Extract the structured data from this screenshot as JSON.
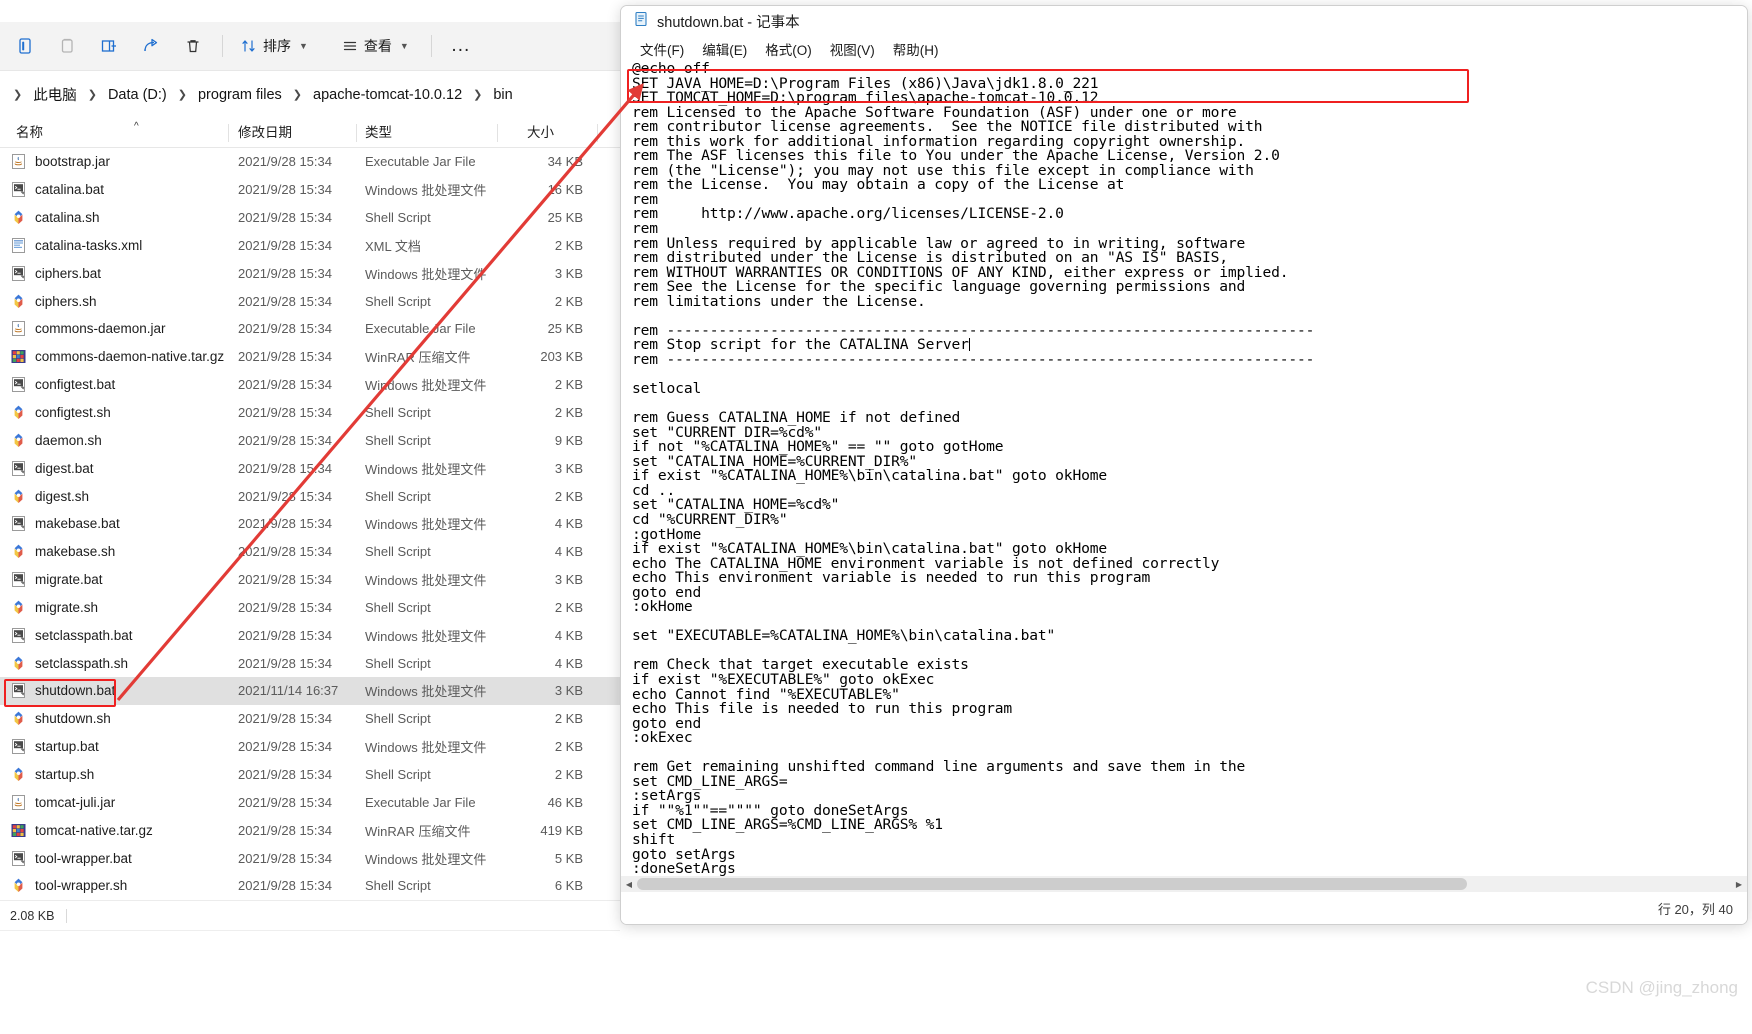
{
  "explorer": {
    "toolbar": {
      "buttons": [
        {
          "name": "new-item-icon",
          "label": ""
        },
        {
          "name": "cut-icon",
          "label": ""
        },
        {
          "name": "copy-icon",
          "label": ""
        },
        {
          "name": "paste-icon",
          "label": ""
        },
        {
          "name": "rename-icon",
          "label": ""
        },
        {
          "name": "share-icon",
          "label": ""
        },
        {
          "name": "delete-icon",
          "label": ""
        }
      ],
      "sort_label": "排序",
      "view_label": "查看",
      "more_label": "..."
    },
    "breadcrumb": [
      "此电脑",
      "Data (D:)",
      "program files",
      "apache-tomcat-10.0.12",
      "bin"
    ],
    "columns": [
      "名称",
      "修改日期",
      "类型",
      "大小"
    ],
    "files": [
      {
        "name": "bootstrap.jar",
        "date": "2021/9/28 15:34",
        "type": "Executable Jar File",
        "size": "34 KB",
        "icon": "jar-icon",
        "selected": false
      },
      {
        "name": "catalina.bat",
        "date": "2021/9/28 15:34",
        "type": "Windows 批处理文件",
        "size": "16 KB",
        "icon": "bat-icon",
        "selected": false
      },
      {
        "name": "catalina.sh",
        "date": "2021/9/28 15:34",
        "type": "Shell Script",
        "size": "25 KB",
        "icon": "sh-icon",
        "selected": false
      },
      {
        "name": "catalina-tasks.xml",
        "date": "2021/9/28 15:34",
        "type": "XML 文档",
        "size": "2 KB",
        "icon": "xml-icon",
        "selected": false
      },
      {
        "name": "ciphers.bat",
        "date": "2021/9/28 15:34",
        "type": "Windows 批处理文件",
        "size": "3 KB",
        "icon": "bat-icon",
        "selected": false
      },
      {
        "name": "ciphers.sh",
        "date": "2021/9/28 15:34",
        "type": "Shell Script",
        "size": "2 KB",
        "icon": "sh-icon",
        "selected": false
      },
      {
        "name": "commons-daemon.jar",
        "date": "2021/9/28 15:34",
        "type": "Executable Jar File",
        "size": "25 KB",
        "icon": "jar-icon",
        "selected": false
      },
      {
        "name": "commons-daemon-native.tar.gz",
        "date": "2021/9/28 15:34",
        "type": "WinRAR 压缩文件",
        "size": "203 KB",
        "icon": "rar-icon",
        "selected": false
      },
      {
        "name": "configtest.bat",
        "date": "2021/9/28 15:34",
        "type": "Windows 批处理文件",
        "size": "2 KB",
        "icon": "bat-icon",
        "selected": false
      },
      {
        "name": "configtest.sh",
        "date": "2021/9/28 15:34",
        "type": "Shell Script",
        "size": "2 KB",
        "icon": "sh-icon",
        "selected": false
      },
      {
        "name": "daemon.sh",
        "date": "2021/9/28 15:34",
        "type": "Shell Script",
        "size": "9 KB",
        "icon": "sh-icon",
        "selected": false
      },
      {
        "name": "digest.bat",
        "date": "2021/9/28 15:34",
        "type": "Windows 批处理文件",
        "size": "3 KB",
        "icon": "bat-icon",
        "selected": false
      },
      {
        "name": "digest.sh",
        "date": "2021/9/28 15:34",
        "type": "Shell Script",
        "size": "2 KB",
        "icon": "sh-icon",
        "selected": false
      },
      {
        "name": "makebase.bat",
        "date": "2021/9/28 15:34",
        "type": "Windows 批处理文件",
        "size": "4 KB",
        "icon": "bat-icon",
        "selected": false
      },
      {
        "name": "makebase.sh",
        "date": "2021/9/28 15:34",
        "type": "Shell Script",
        "size": "4 KB",
        "icon": "sh-icon",
        "selected": false
      },
      {
        "name": "migrate.bat",
        "date": "2021/9/28 15:34",
        "type": "Windows 批处理文件",
        "size": "3 KB",
        "icon": "bat-icon",
        "selected": false
      },
      {
        "name": "migrate.sh",
        "date": "2021/9/28 15:34",
        "type": "Shell Script",
        "size": "2 KB",
        "icon": "sh-icon",
        "selected": false
      },
      {
        "name": "setclasspath.bat",
        "date": "2021/9/28 15:34",
        "type": "Windows 批处理文件",
        "size": "4 KB",
        "icon": "bat-icon",
        "selected": false
      },
      {
        "name": "setclasspath.sh",
        "date": "2021/9/28 15:34",
        "type": "Shell Script",
        "size": "4 KB",
        "icon": "sh-icon",
        "selected": false
      },
      {
        "name": "shutdown.bat",
        "date": "2021/11/14 16:37",
        "type": "Windows 批处理文件",
        "size": "3 KB",
        "icon": "bat-icon",
        "selected": true
      },
      {
        "name": "shutdown.sh",
        "date": "2021/9/28 15:34",
        "type": "Shell Script",
        "size": "2 KB",
        "icon": "sh-icon",
        "selected": false
      },
      {
        "name": "startup.bat",
        "date": "2021/9/28 15:34",
        "type": "Windows 批处理文件",
        "size": "2 KB",
        "icon": "bat-icon",
        "selected": false
      },
      {
        "name": "startup.sh",
        "date": "2021/9/28 15:34",
        "type": "Shell Script",
        "size": "2 KB",
        "icon": "sh-icon",
        "selected": false
      },
      {
        "name": "tomcat-juli.jar",
        "date": "2021/9/28 15:34",
        "type": "Executable Jar File",
        "size": "46 KB",
        "icon": "jar-icon",
        "selected": false
      },
      {
        "name": "tomcat-native.tar.gz",
        "date": "2021/9/28 15:34",
        "type": "WinRAR 压缩文件",
        "size": "419 KB",
        "icon": "rar-icon",
        "selected": false
      },
      {
        "name": "tool-wrapper.bat",
        "date": "2021/9/28 15:34",
        "type": "Windows 批处理文件",
        "size": "5 KB",
        "icon": "bat-icon",
        "selected": false
      },
      {
        "name": "tool-wrapper.sh",
        "date": "2021/9/28 15:34",
        "type": "Shell Script",
        "size": "6 KB",
        "icon": "sh-icon",
        "selected": false
      }
    ],
    "status": "2.08 KB"
  },
  "notepad": {
    "title": "shutdown.bat - 记事本",
    "menus": [
      "文件(F)",
      "编辑(E)",
      "格式(O)",
      "视图(V)",
      "帮助(H)"
    ],
    "status": "行 20，列 40",
    "content": "@echo off\nSET JAVA_HOME=D:\\Program Files (x86)\\Java\\jdk1.8.0_221\nSET TOMCAT_HOME=D:\\program files\\apache-tomcat-10.0.12\nrem Licensed to the Apache Software Foundation (ASF) under one or more\nrem contributor license agreements.  See the NOTICE file distributed with\nrem this work for additional information regarding copyright ownership.\nrem The ASF licenses this file to You under the Apache License, Version 2.0\nrem (the \"License\"); you may not use this file except in compliance with\nrem the License.  You may obtain a copy of the License at\nrem\nrem     http://www.apache.org/licenses/LICENSE-2.0\nrem\nrem Unless required by applicable law or agreed to in writing, software\nrem distributed under the License is distributed on an \"AS IS\" BASIS,\nrem WITHOUT WARRANTIES OR CONDITIONS OF ANY KIND, either express or implied.\nrem See the License for the specific language governing permissions and\nrem limitations under the License.\n\nrem ---------------------------------------------------------------------------\nrem Stop script for the CATALINA Server\nrem ---------------------------------------------------------------------------\n\nsetlocal\n\nrem Guess CATALINA_HOME if not defined\nset \"CURRENT_DIR=%cd%\"\nif not \"%CATALINA_HOME%\" == \"\" goto gotHome\nset \"CATALINA_HOME=%CURRENT_DIR%\"\nif exist \"%CATALINA_HOME%\\bin\\catalina.bat\" goto okHome\ncd ..\nset \"CATALINA_HOME=%cd%\"\ncd \"%CURRENT_DIR%\"\n:gotHome\nif exist \"%CATALINA_HOME%\\bin\\catalina.bat\" goto okHome\necho The CATALINA_HOME environment variable is not defined correctly\necho This environment variable is needed to run this program\ngoto end\n:okHome\n\nset \"EXECUTABLE=%CATALINA_HOME%\\bin\\catalina.bat\"\n\nrem Check that target executable exists\nif exist \"%EXECUTABLE%\" goto okExec\necho Cannot find \"%EXECUTABLE%\"\necho This file is needed to run this program\ngoto end\n:okExec\n\nrem Get remaining unshifted command line arguments and save them in the\nset CMD_LINE_ARGS=\n:setArgs\nif \"\"%1\"\"==\"\"\"\" goto doneSetArgs\nset CMD_LINE_ARGS=%CMD_LINE_ARGS% %1\nshift\ngoto setArgs\n:doneSetArgs\n\ncall \"%EXECUTABLE%\" stop %CMD_LINE_ARGS%"
  },
  "watermark": "CSDN @jing_zhong",
  "colors": {
    "highlight_red": "#ef2020",
    "arrow_red": "#e23b36",
    "selection_gray": "#e0e0e0"
  }
}
